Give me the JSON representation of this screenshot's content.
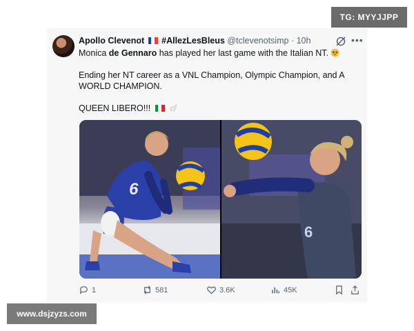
{
  "watermarks": {
    "top": "TG: MYYJJPP",
    "bottom": "www.dsjzyzs.com"
  },
  "tweet": {
    "author_name": "Apollo Clevenot",
    "hashtag": "#AllezLesBleus",
    "handle": "@tclevenotsimp",
    "separator": "·",
    "time": "10h",
    "line1_pre": "Monica ",
    "line1_bold": "de Gennaro",
    "line1_post": " has played her last game with the Italian NT.",
    "line2": "Ending her NT career as a VNL Champion, Olympic Champion, and A WORLD CHAMPION.",
    "line3": "QUEEN LIBERO!!!",
    "jersey_left": "6",
    "jersey_right": "6"
  },
  "actions": {
    "replies": "1",
    "reposts": "581",
    "likes": "3.6K",
    "views": "45K"
  },
  "colors": {
    "text": "#0f1419",
    "muted": "#536471",
    "italy_green": "#009246",
    "italy_red": "#ce2b37",
    "france_blue": "#0055a4",
    "france_red": "#ef4135",
    "jersey_blue": "#2b3fa8",
    "ball_yellow": "#f5c419"
  },
  "icons": [
    "france-flag-icon",
    "italy-flag-icon",
    "grok-icon",
    "more-icon",
    "pleading-face-emoji-icon",
    "goat-emoji-icon",
    "reply-icon",
    "repost-icon",
    "like-icon",
    "views-icon",
    "bookmark-icon",
    "share-icon"
  ]
}
